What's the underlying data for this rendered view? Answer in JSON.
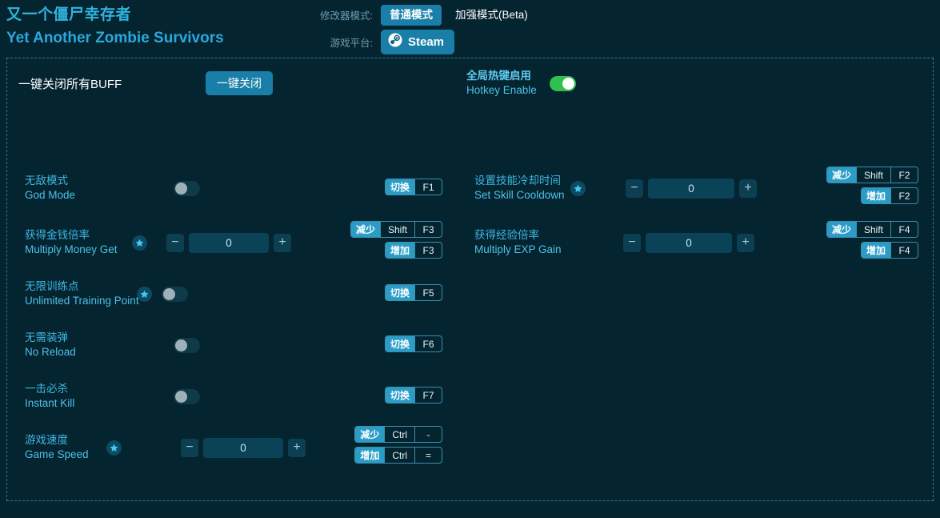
{
  "header": {
    "title_cn": "又一个僵尸幸存者",
    "title_en": "Yet Another Zombie Survivors",
    "mode_label": "修改器模式:",
    "mode_normal": "普通模式",
    "mode_enhanced": "加强模式(Beta)",
    "platform_label": "游戏平台:",
    "platform_value": "Steam"
  },
  "left": {
    "buff_label": "一键关闭所有BUFF",
    "buff_button": "一键关闭",
    "rows": [
      {
        "cn": "无敌模式",
        "en": "God Mode",
        "control": "toggle",
        "toggle_on": false,
        "star": false,
        "hotkeys": [
          {
            "action": "切换",
            "keys": [
              "F1"
            ]
          }
        ]
      },
      {
        "cn": "获得金钱倍率",
        "en": "Multiply Money Get",
        "control": "stepper",
        "value": "0",
        "star": true,
        "hotkeys": [
          {
            "action": "减少",
            "keys": [
              "Shift",
              "F3"
            ]
          },
          {
            "action": "增加",
            "keys": [
              "F3"
            ]
          }
        ]
      },
      {
        "cn": "无限训练点",
        "en": "Unlimited Training Point",
        "control": "toggle",
        "toggle_on": false,
        "star": true,
        "hotkeys": [
          {
            "action": "切换",
            "keys": [
              "F5"
            ]
          }
        ]
      },
      {
        "cn": "无需装弹",
        "en": "No Reload",
        "control": "toggle",
        "toggle_on": false,
        "star": false,
        "hotkeys": [
          {
            "action": "切换",
            "keys": [
              "F6"
            ]
          }
        ]
      },
      {
        "cn": "一击必杀",
        "en": "Instant Kill",
        "control": "toggle",
        "toggle_on": false,
        "star": false,
        "hotkeys": [
          {
            "action": "切换",
            "keys": [
              "F7"
            ]
          }
        ]
      },
      {
        "cn": "游戏速度",
        "en": "Game Speed",
        "control": "stepper",
        "value": "0",
        "star": true,
        "hotkeys": [
          {
            "action": "减少",
            "keys": [
              "Ctrl",
              "-"
            ]
          },
          {
            "action": "增加",
            "keys": [
              "Ctrl",
              "="
            ]
          }
        ]
      }
    ]
  },
  "right": {
    "hotkey_enable_cn": "全局热键启用",
    "hotkey_enable_en": "Hotkey Enable",
    "hotkey_enable_on": true,
    "rows": [
      {
        "cn": "设置技能冷却时间",
        "en": "Set Skill Cooldown",
        "control": "stepper",
        "value": "0",
        "star": true,
        "hotkeys": [
          {
            "action": "减少",
            "keys": [
              "Shift",
              "F2"
            ]
          },
          {
            "action": "增加",
            "keys": [
              "F2"
            ]
          }
        ]
      },
      {
        "cn": "获得经验倍率",
        "en": "Multiply EXP Gain",
        "control": "stepper",
        "value": "0",
        "star": false,
        "hotkeys": [
          {
            "action": "减少",
            "keys": [
              "Shift",
              "F4"
            ]
          },
          {
            "action": "增加",
            "keys": [
              "F4"
            ]
          }
        ]
      }
    ]
  },
  "colors": {
    "background": "#04242f",
    "accent": "#2a9cc6",
    "button": "#1a7fa8",
    "label_cn": "#3fb6e4",
    "toggle_on": "#2fc14e",
    "border_dashed": "#2e7f9b"
  }
}
